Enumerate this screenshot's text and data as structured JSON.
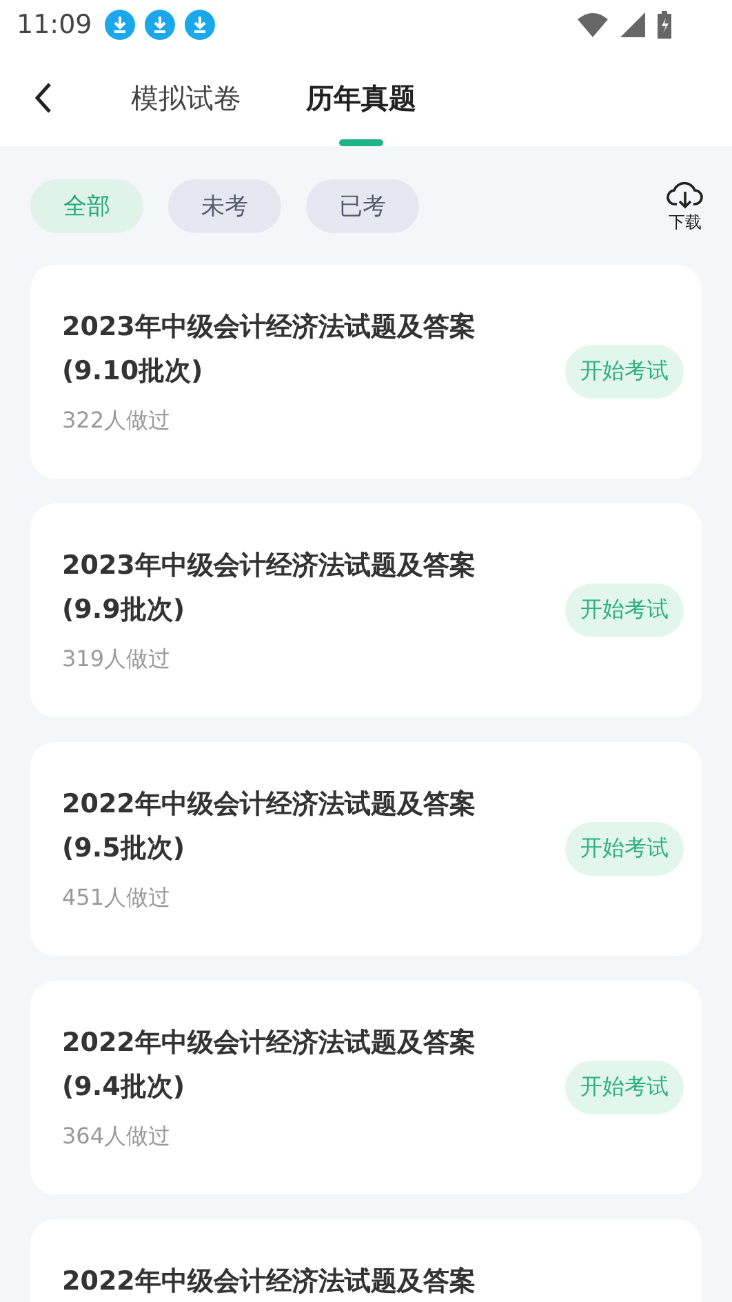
{
  "status_bar": {
    "time": "11:09",
    "notifications": [
      {
        "kind": "download"
      },
      {
        "kind": "download"
      },
      {
        "kind": "download"
      }
    ]
  },
  "tabs": [
    {
      "label": "模拟试卷",
      "selected": false
    },
    {
      "label": "历年真题",
      "selected": true
    }
  ],
  "filters": [
    {
      "label": "全部",
      "selected": true
    },
    {
      "label": "未考",
      "selected": false
    },
    {
      "label": "已考",
      "selected": false
    }
  ],
  "download": {
    "label": "下载"
  },
  "papers": [
    {
      "title": "2023年中级会计经济法试题及答案(9.10批次)",
      "count": "322人做过",
      "action": "开始考试"
    },
    {
      "title": "2023年中级会计经济法试题及答案(9.9批次)",
      "count": "319人做过",
      "action": "开始考试"
    },
    {
      "title": "2022年中级会计经济法试题及答案(9.5批次)",
      "count": "451人做过",
      "action": "开始考试"
    },
    {
      "title": "2022年中级会计经济法试题及答案(9.4批次)",
      "count": "364人做过",
      "action": "开始考试"
    },
    {
      "title": "2022年中级会计经济法试题及答案"
    }
  ]
}
